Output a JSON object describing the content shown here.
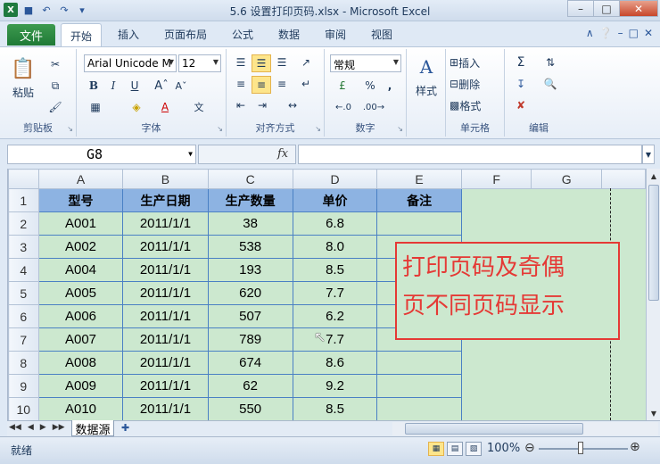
{
  "window": {
    "title": "5.6 设置打印页码.xlsx - Microsoft Excel",
    "app_icon": "X"
  },
  "ribbon_tabs": {
    "file": "文件",
    "home": "开始",
    "insert": "插入",
    "page_layout": "页面布局",
    "formulas": "公式",
    "data": "数据",
    "review": "审阅",
    "view": "视图"
  },
  "groups": {
    "clipboard": {
      "label": "剪贴板",
      "paste": "粘贴"
    },
    "font": {
      "label": "字体",
      "font_name": "Arial Unicode M",
      "font_size": "12"
    },
    "alignment": {
      "label": "对齐方式"
    },
    "number": {
      "label": "数字",
      "format": "常规",
      "percent": "%",
      "comma": ","
    },
    "styles": {
      "label": "样式"
    },
    "cells": {
      "label": "单元格",
      "insert": "插入",
      "delete": "删除",
      "format": "格式"
    },
    "editing": {
      "label": "编辑"
    }
  },
  "formula_bar": {
    "name_box": "G8",
    "fx": "fx",
    "formula": ""
  },
  "columns": [
    "A",
    "B",
    "C",
    "D",
    "E",
    "F",
    "G"
  ],
  "headers": [
    "型号",
    "生产日期",
    "生产数量",
    "单价",
    "备注"
  ],
  "rows": [
    {
      "num": "1"
    },
    {
      "num": "2",
      "model": "A001",
      "date": "2011/1/1",
      "qty": "38",
      "price": "6.8"
    },
    {
      "num": "3",
      "model": "A002",
      "date": "2011/1/1",
      "qty": "538",
      "price": "8.0"
    },
    {
      "num": "4",
      "model": "A004",
      "date": "2011/1/1",
      "qty": "193",
      "price": "8.5"
    },
    {
      "num": "5",
      "model": "A005",
      "date": "2011/1/1",
      "qty": "620",
      "price": "7.7"
    },
    {
      "num": "6",
      "model": "A006",
      "date": "2011/1/1",
      "qty": "507",
      "price": "6.2"
    },
    {
      "num": "7",
      "model": "A007",
      "date": "2011/1/1",
      "qty": "789",
      "price": "7.7"
    },
    {
      "num": "8",
      "model": "A008",
      "date": "2011/1/1",
      "qty": "674",
      "price": "8.6"
    },
    {
      "num": "9",
      "model": "A009",
      "date": "2011/1/1",
      "qty": "62",
      "price": "9.2"
    },
    {
      "num": "10",
      "model": "A010",
      "date": "2011/1/1",
      "qty": "550",
      "price": "8.5"
    }
  ],
  "callout": {
    "line1": "打印页码及奇偶",
    "line2": "页不同页码显示"
  },
  "sheet_tabs": {
    "active": "数据源"
  },
  "status": {
    "ready": "就绪",
    "zoom": "100%"
  },
  "colors": {
    "header_fill": "#8db3e2",
    "sheet_bg": "#cce8cf",
    "callout": "#e53935"
  }
}
